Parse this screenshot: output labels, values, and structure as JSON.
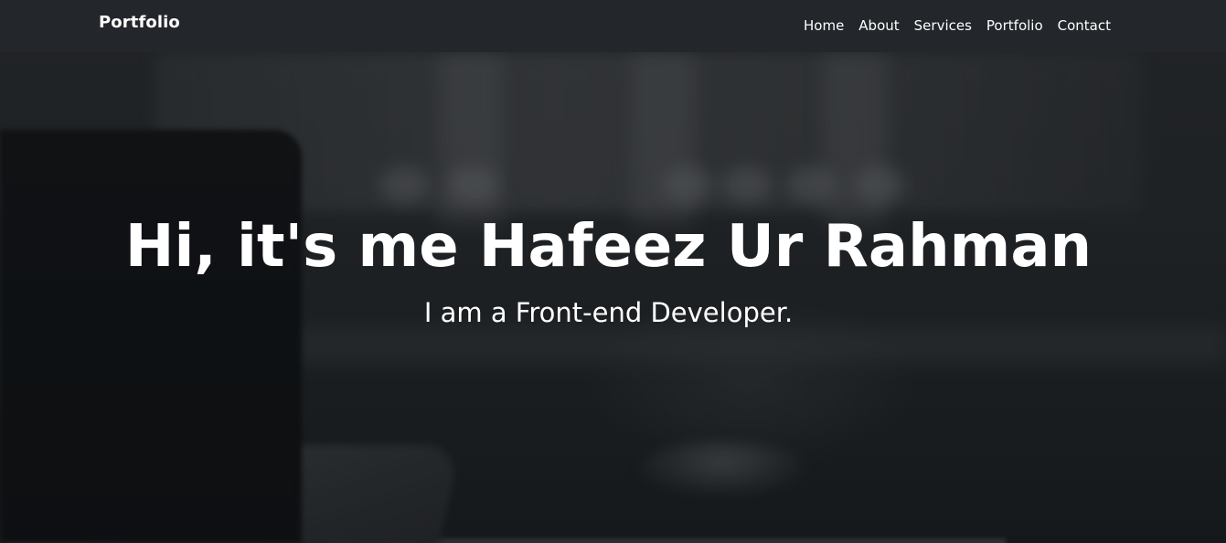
{
  "navbar": {
    "brand": "Portfolio",
    "links": [
      "Home",
      "About",
      "Services",
      "Portfolio",
      "Contact"
    ]
  },
  "hero": {
    "title": "Hi, it's me Hafeez Ur Rahman",
    "subtitle": "I am a Front-end Developer."
  },
  "colors": {
    "navbar_bg": "#23262b",
    "text": "#ffffff"
  }
}
